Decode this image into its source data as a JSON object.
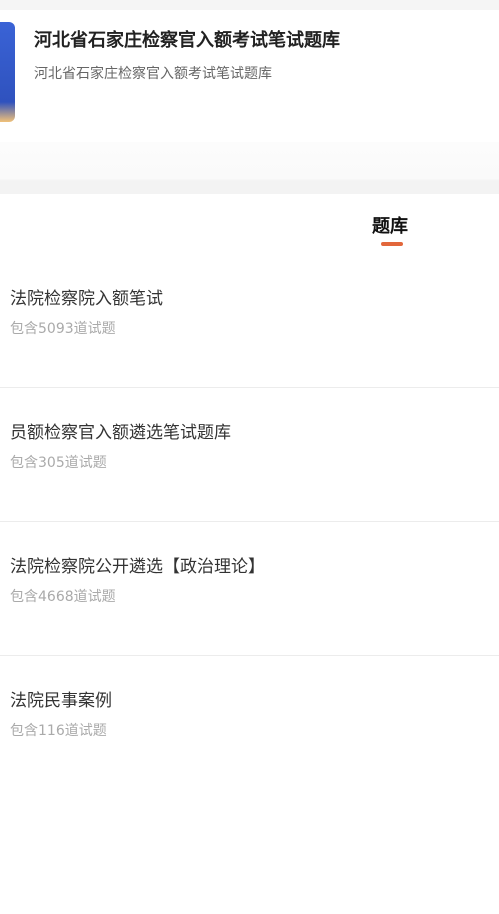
{
  "header": {
    "title": "河北省石家庄检察官入额考试笔试题库",
    "subtitle": "河北省石家庄检察官入额考试笔试题库"
  },
  "tabs": [
    {
      "label": "题库",
      "active": true
    }
  ],
  "colors": {
    "accent": "#e2673b",
    "thumb": "#2f52be"
  },
  "bank_list": [
    {
      "title": "法院检察院入额笔试",
      "count": "包含5093道试题"
    },
    {
      "title": "员额检察官入额遴选笔试题库",
      "count": "包含305道试题"
    },
    {
      "title": "法院检察院公开遴选【政治理论】",
      "count": "包含4668道试题"
    },
    {
      "title": "法院民事案例",
      "count": "包含116道试题"
    }
  ]
}
